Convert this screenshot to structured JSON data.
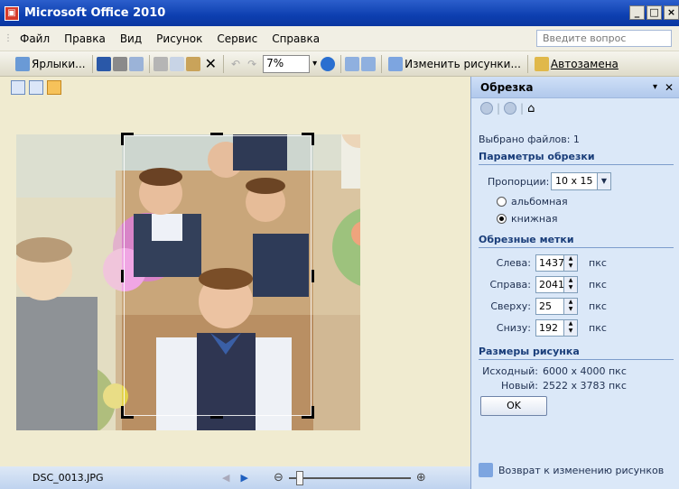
{
  "window": {
    "title": "Microsoft Office 2010",
    "app_icon": "office-picture-icon"
  },
  "menu": {
    "items": [
      "Файл",
      "Правка",
      "Вид",
      "Рисунок",
      "Сервис",
      "Справка"
    ],
    "ask_placeholder": "Введите вопрос"
  },
  "toolbar": {
    "shortcuts_label": "Ярлыки...",
    "zoom": "7%",
    "edit_pictures_label": "Изменить рисунки...",
    "autocorrect_label": "Автозамена"
  },
  "status": {
    "filename": "DSC_0013.JPG",
    "zoom_level_fraction": 0.06
  },
  "panel": {
    "title": "Обрезка",
    "selected_files": "Выбрано файлов: 1",
    "crop_params_header": "Параметры обрезки",
    "proportions_label": "Пропорции:",
    "proportions_value": "10 x 15",
    "landscape_label": "альбомная",
    "portrait_label": "книжная",
    "orientation_selected": "portrait",
    "crop_marks_header": "Обрезные метки",
    "left_label": "Слева:",
    "left_value": "1437",
    "right_label": "Справа:",
    "right_value": "2041",
    "top_label": "Сверху:",
    "top_value": "25",
    "bottom_label": "Снизу:",
    "bottom_value": "192",
    "unit": "пкс",
    "picture_size_header": "Размеры рисунка",
    "original_label": "Исходный:",
    "original_value": "6000 x 4000 пкс",
    "new_label": "Новый:",
    "new_value": "2522 x 3783 пкс",
    "ok_label": "OK",
    "back_link": "Возврат к изменению рисунков"
  }
}
